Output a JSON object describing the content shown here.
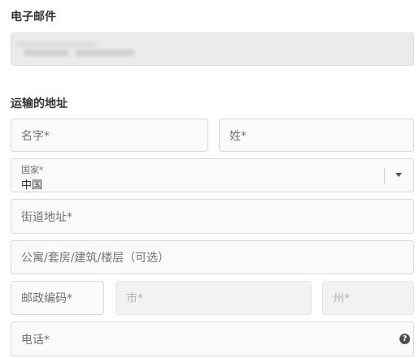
{
  "email_section": {
    "title": "电子邮件"
  },
  "shipping_section": {
    "title": "运输的地址",
    "first_name_placeholder": "名字*",
    "last_name_placeholder": "姓*",
    "country": {
      "label": "国家*",
      "value": "中国",
      "icon": "chevron-down-icon"
    },
    "street_placeholder": "街道地址*",
    "apartment_placeholder": "公寓/套房/建筑/楼层（可选）",
    "zip_placeholder": "邮政编码*",
    "city_placeholder": "市*",
    "state_placeholder": "州*",
    "phone_placeholder": "电话*",
    "phone_help_icon": "help-icon",
    "phone_help_glyph": "?"
  },
  "colors": {
    "field_border": "#d9d9d9",
    "field_background": "#fafafa",
    "disabled_background": "#f2f2f2",
    "text": "#333333",
    "placeholder": "#737373"
  }
}
